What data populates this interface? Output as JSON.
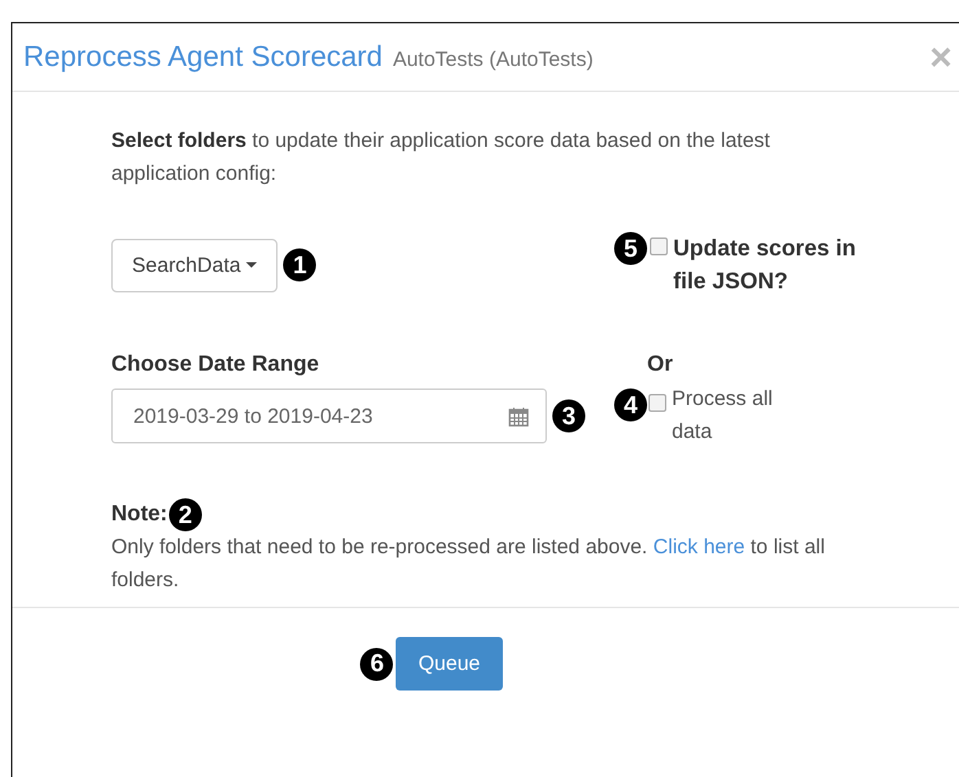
{
  "window": {
    "title": "Reprocess Agent Scorecard",
    "subtitle": "AutoTests (AutoTests)",
    "close": "×"
  },
  "intro": "**Select folders** to update their application score data based on the latest application config:",
  "folder_dropdown": {
    "value": "SearchData",
    "badge": "1"
  },
  "update_json": {
    "label": "Update scores in file JSON?",
    "checked": false,
    "badge": "5"
  },
  "date_range": {
    "label": "Choose Date Range",
    "value": "2019-03-29 to 2019-04-23",
    "badge": "3"
  },
  "or_label": "Or",
  "process_all": {
    "label": "Process all data",
    "checked": false,
    "badge": "4"
  },
  "note": {
    "title": "Note:",
    "badge": "2",
    "text_before": "Only folders that need to be re-processed are listed above.",
    "link": "Click here",
    "text_after": "to list all folders."
  },
  "footer": {
    "button": "Queue",
    "badge": "6"
  }
}
